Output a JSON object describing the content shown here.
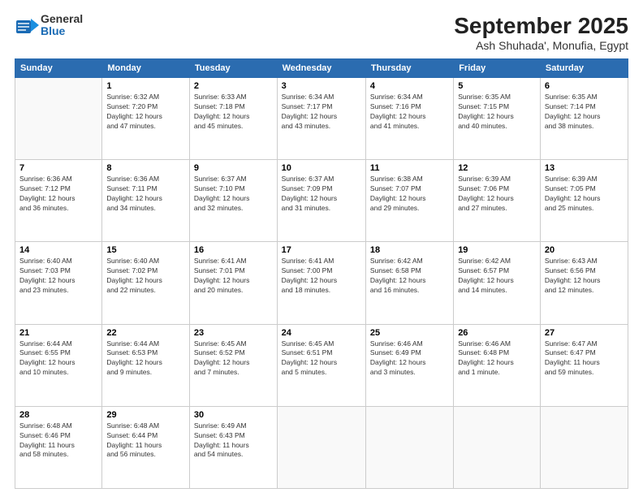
{
  "header": {
    "logo_general": "General",
    "logo_blue": "Blue",
    "month_title": "September 2025",
    "location": "Ash Shuhada', Monufia, Egypt"
  },
  "weekdays": [
    "Sunday",
    "Monday",
    "Tuesday",
    "Wednesday",
    "Thursday",
    "Friday",
    "Saturday"
  ],
  "weeks": [
    [
      {
        "day": "",
        "info": ""
      },
      {
        "day": "1",
        "info": "Sunrise: 6:32 AM\nSunset: 7:20 PM\nDaylight: 12 hours\nand 47 minutes."
      },
      {
        "day": "2",
        "info": "Sunrise: 6:33 AM\nSunset: 7:18 PM\nDaylight: 12 hours\nand 45 minutes."
      },
      {
        "day": "3",
        "info": "Sunrise: 6:34 AM\nSunset: 7:17 PM\nDaylight: 12 hours\nand 43 minutes."
      },
      {
        "day": "4",
        "info": "Sunrise: 6:34 AM\nSunset: 7:16 PM\nDaylight: 12 hours\nand 41 minutes."
      },
      {
        "day": "5",
        "info": "Sunrise: 6:35 AM\nSunset: 7:15 PM\nDaylight: 12 hours\nand 40 minutes."
      },
      {
        "day": "6",
        "info": "Sunrise: 6:35 AM\nSunset: 7:14 PM\nDaylight: 12 hours\nand 38 minutes."
      }
    ],
    [
      {
        "day": "7",
        "info": "Sunrise: 6:36 AM\nSunset: 7:12 PM\nDaylight: 12 hours\nand 36 minutes."
      },
      {
        "day": "8",
        "info": "Sunrise: 6:36 AM\nSunset: 7:11 PM\nDaylight: 12 hours\nand 34 minutes."
      },
      {
        "day": "9",
        "info": "Sunrise: 6:37 AM\nSunset: 7:10 PM\nDaylight: 12 hours\nand 32 minutes."
      },
      {
        "day": "10",
        "info": "Sunrise: 6:37 AM\nSunset: 7:09 PM\nDaylight: 12 hours\nand 31 minutes."
      },
      {
        "day": "11",
        "info": "Sunrise: 6:38 AM\nSunset: 7:07 PM\nDaylight: 12 hours\nand 29 minutes."
      },
      {
        "day": "12",
        "info": "Sunrise: 6:39 AM\nSunset: 7:06 PM\nDaylight: 12 hours\nand 27 minutes."
      },
      {
        "day": "13",
        "info": "Sunrise: 6:39 AM\nSunset: 7:05 PM\nDaylight: 12 hours\nand 25 minutes."
      }
    ],
    [
      {
        "day": "14",
        "info": "Sunrise: 6:40 AM\nSunset: 7:03 PM\nDaylight: 12 hours\nand 23 minutes."
      },
      {
        "day": "15",
        "info": "Sunrise: 6:40 AM\nSunset: 7:02 PM\nDaylight: 12 hours\nand 22 minutes."
      },
      {
        "day": "16",
        "info": "Sunrise: 6:41 AM\nSunset: 7:01 PM\nDaylight: 12 hours\nand 20 minutes."
      },
      {
        "day": "17",
        "info": "Sunrise: 6:41 AM\nSunset: 7:00 PM\nDaylight: 12 hours\nand 18 minutes."
      },
      {
        "day": "18",
        "info": "Sunrise: 6:42 AM\nSunset: 6:58 PM\nDaylight: 12 hours\nand 16 minutes."
      },
      {
        "day": "19",
        "info": "Sunrise: 6:42 AM\nSunset: 6:57 PM\nDaylight: 12 hours\nand 14 minutes."
      },
      {
        "day": "20",
        "info": "Sunrise: 6:43 AM\nSunset: 6:56 PM\nDaylight: 12 hours\nand 12 minutes."
      }
    ],
    [
      {
        "day": "21",
        "info": "Sunrise: 6:44 AM\nSunset: 6:55 PM\nDaylight: 12 hours\nand 10 minutes."
      },
      {
        "day": "22",
        "info": "Sunrise: 6:44 AM\nSunset: 6:53 PM\nDaylight: 12 hours\nand 9 minutes."
      },
      {
        "day": "23",
        "info": "Sunrise: 6:45 AM\nSunset: 6:52 PM\nDaylight: 12 hours\nand 7 minutes."
      },
      {
        "day": "24",
        "info": "Sunrise: 6:45 AM\nSunset: 6:51 PM\nDaylight: 12 hours\nand 5 minutes."
      },
      {
        "day": "25",
        "info": "Sunrise: 6:46 AM\nSunset: 6:49 PM\nDaylight: 12 hours\nand 3 minutes."
      },
      {
        "day": "26",
        "info": "Sunrise: 6:46 AM\nSunset: 6:48 PM\nDaylight: 12 hours\nand 1 minute."
      },
      {
        "day": "27",
        "info": "Sunrise: 6:47 AM\nSunset: 6:47 PM\nDaylight: 11 hours\nand 59 minutes."
      }
    ],
    [
      {
        "day": "28",
        "info": "Sunrise: 6:48 AM\nSunset: 6:46 PM\nDaylight: 11 hours\nand 58 minutes."
      },
      {
        "day": "29",
        "info": "Sunrise: 6:48 AM\nSunset: 6:44 PM\nDaylight: 11 hours\nand 56 minutes."
      },
      {
        "day": "30",
        "info": "Sunrise: 6:49 AM\nSunset: 6:43 PM\nDaylight: 11 hours\nand 54 minutes."
      },
      {
        "day": "",
        "info": ""
      },
      {
        "day": "",
        "info": ""
      },
      {
        "day": "",
        "info": ""
      },
      {
        "day": "",
        "info": ""
      }
    ]
  ]
}
